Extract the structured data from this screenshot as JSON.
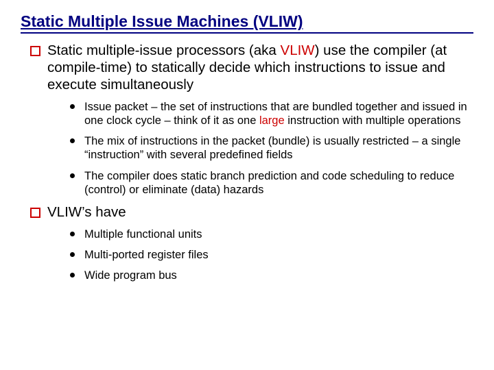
{
  "title": "Static Multiple Issue Machines (VLIW)",
  "section1": {
    "pre": "Static multiple-issue processors (aka ",
    "red": "VLIW",
    "post": ") use the compiler (at compile-time) to statically decide which instructions to issue and execute simultaneously"
  },
  "bullets1": {
    "b0": {
      "pre": "Issue packet – the set of instructions that are bundled together and issued in one clock cycle – think of it as one ",
      "red": "large",
      "post": " instruction with multiple operations"
    },
    "b1": {
      "text": "The mix of instructions in the packet (bundle) is usually restricted – a single “instruction” with several predefined fields"
    },
    "b2": {
      "text": "The compiler does static branch prediction and code scheduling to reduce (control) or eliminate (data) hazards"
    }
  },
  "section2": {
    "text": "VLIW’s have"
  },
  "bullets2": {
    "b0": {
      "text": "Multiple functional units"
    },
    "b1": {
      "text": "Multi-ported register files"
    },
    "b2": {
      "text": "Wide program bus"
    }
  }
}
